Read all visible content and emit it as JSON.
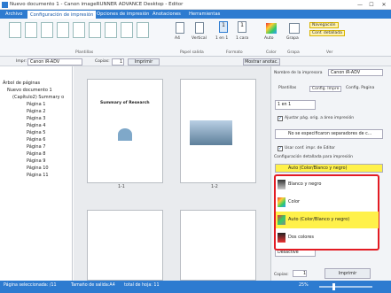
{
  "window": {
    "title": "Nuevo documento 1 - Canon imageRUNNER ADVANCE Desktop - Editor",
    "min": "—",
    "max": "☐",
    "close": "✕"
  },
  "ribbon_tabs": [
    "Archivo",
    "Configuración de impresión",
    "Opciones de impresión",
    "Anotaciones",
    "Herramientas"
  ],
  "ribbon": {
    "groups": [
      "Plantillas",
      "Papel salida",
      "Formato",
      "Color",
      "Grapa",
      "Ver"
    ],
    "paper": "A4",
    "orientation": "Vertical",
    "layout_a": "1 en 1",
    "layout_b": "1 cara",
    "color": "Auto",
    "staple": "Grapa",
    "view_navigation": "Navegación",
    "view_detail": "Conf. detallada"
  },
  "toolbar": {
    "printer_label": "Impr:",
    "printer_value": "Canon iR-ADV",
    "copies_label": "Copias:",
    "copies_value": "1",
    "print_button": "Imprimir",
    "show_annotations": "Mostrar anotac."
  },
  "tree": {
    "header": "Árbol de páginas",
    "document": "Nuevo documento 1",
    "chapter": "(Capítulo2) Summary o",
    "pages": [
      "Página 1",
      "Página 2",
      "Página 3",
      "Página 4",
      "Página 5",
      "Página 6",
      "Página 7",
      "Página 8",
      "Página 9",
      "Página 10",
      "Página 11"
    ]
  },
  "preview": {
    "labels": [
      "1-1",
      "1-2"
    ],
    "page1_text": "Summary of Research"
  },
  "right": {
    "profile_label": "Nombre de la impresora",
    "profile_value": "Canon iR-ADV",
    "tabs": [
      "Plantillas",
      "Config. Impre",
      "Config. Pagina"
    ],
    "layout_value": "1 en 1",
    "chk_adjust": "Ajustar pág. orig. a área impresión",
    "separators": "No se especificaron separadores de c...",
    "chk_user": "Usar conf. impr. de Editor",
    "detail_label": "Configuración detallada para impresión",
    "color_selected": "Auto (Color/Blanco y negro)",
    "color_options": [
      "Blanco y negro",
      "Color",
      "Auto (Color/Blanco y negro)",
      "Dos colores"
    ],
    "off_value": "Desactivé",
    "copies_label": "Copias:",
    "copies_value": "1",
    "print_button": "Imprimir"
  },
  "status": {
    "selected": "Página seleccionada: /11",
    "size": "Tamaño de salida:A4",
    "total": "total de hoja: 11",
    "zoom": "25%"
  },
  "colors": {
    "accent": "#2d7bd0",
    "highlight": "#e31b23",
    "selected": "#fff14a"
  }
}
